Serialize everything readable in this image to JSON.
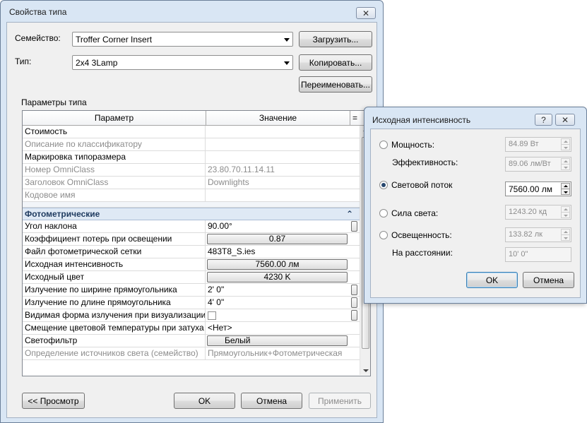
{
  "main_window": {
    "title": "Свойства типа",
    "close_glyph": "✕",
    "family_label": "Семейство:",
    "family_value": "Troffer Corner Insert",
    "type_label": "Тип:",
    "type_value": "2x4 3Lamp",
    "load_button": "Загрузить...",
    "duplicate_button": "Копировать...",
    "rename_button": "Переименовать...",
    "type_params_label": "Параметры типа",
    "table": {
      "col_param": "Параметр",
      "col_value": "Значение",
      "col_menu": "=",
      "rows_top": [
        {
          "name": "Стоимость",
          "value": "",
          "gray": false
        },
        {
          "name": "Описание по классификатору",
          "value": "",
          "gray": true
        },
        {
          "name": "Маркировка типоразмера",
          "value": "",
          "gray": false
        },
        {
          "name": "Номер OmniClass",
          "value": "23.80.70.11.14.11",
          "gray": true
        },
        {
          "name": "Заголовок OmniClass",
          "value": "Downlights",
          "gray": true
        },
        {
          "name": "Кодовое имя",
          "value": "",
          "gray": true
        }
      ],
      "group_title": "Фотометрические",
      "group_collapse": "⌃",
      "rows_photo": [
        {
          "name": "Угол наклона",
          "value": "90.00°"
        },
        {
          "name": "Коэффициент потерь при освещении",
          "value": "0.87"
        },
        {
          "name": "Файл фотометрической сетки",
          "value": "483T8_S.ies"
        },
        {
          "name": "Исходная интенсивность",
          "value": "7560.00 лм"
        },
        {
          "name": "Исходный цвет",
          "value": "4230 K"
        },
        {
          "name": "Излучение по ширине прямоугольника",
          "value": "2'  0\""
        },
        {
          "name": "Излучение по длине прямоугольника",
          "value": "4'  0\""
        },
        {
          "name": "Видимая форма излучения при визуализации",
          "value": ""
        },
        {
          "name": "Смещение цветовой температуры при затуха",
          "value": "<Нет>"
        },
        {
          "name": "Светофильтр",
          "value": "Белый"
        },
        {
          "name": "Определение источников света (семейство)",
          "value": "Прямоугольник+Фотометрическая"
        }
      ]
    },
    "preview_button": "<< Просмотр",
    "ok_button": "OK",
    "cancel_button": "Отмена",
    "apply_button": "Применить"
  },
  "intensity_dialog": {
    "title": "Исходная интенсивность",
    "help_glyph": "?",
    "close_glyph": "✕",
    "wattage_label": "Мощность:",
    "wattage_value": "84.89 Вт",
    "efficacy_label": "Эффективность:",
    "efficacy_value": "89.06 лм/Вт",
    "flux_label": "Световой поток",
    "flux_value": "7560.00 лм",
    "intensity_label": "Сила света:",
    "intensity_value": "1243.20 кд",
    "illuminance_label": "Освещенность:",
    "illuminance_value": "133.82 лк",
    "distance_label": "На расстоянии:",
    "distance_value": "10'  0\"",
    "ok_button": "OK",
    "cancel_button": "Отмена",
    "selected": "flux"
  }
}
